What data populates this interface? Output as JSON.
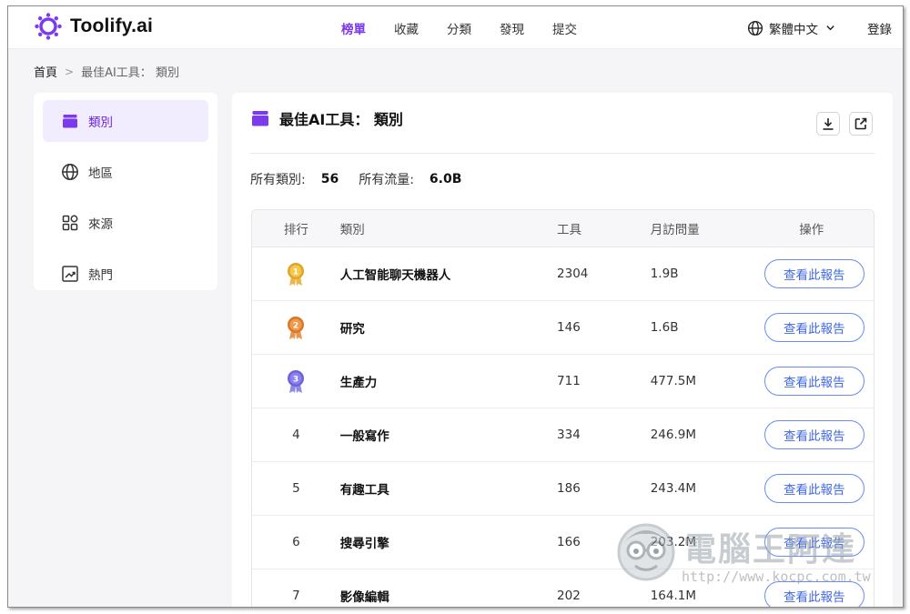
{
  "header": {
    "logo_text": "Toolify.ai",
    "nav": [
      {
        "label": "榜單",
        "active": true
      },
      {
        "label": "收藏",
        "active": false
      },
      {
        "label": "分類",
        "active": false
      },
      {
        "label": "發現",
        "active": false
      },
      {
        "label": "提交",
        "active": false
      }
    ],
    "language": "繁體中文",
    "login": "登錄"
  },
  "breadcrumb": {
    "home": "首頁",
    "current": "最佳AI工具： 類別"
  },
  "sidebar": {
    "items": [
      {
        "label": "類別",
        "icon": "folder-icon",
        "active": true
      },
      {
        "label": "地區",
        "icon": "globe-icon",
        "active": false
      },
      {
        "label": "來源",
        "icon": "apps-icon",
        "active": false
      },
      {
        "label": "熱門",
        "icon": "trending-icon",
        "active": false
      }
    ]
  },
  "main": {
    "title": "最佳AI工具： 類別",
    "stats": {
      "categories_label": "所有類別:",
      "categories_value": "56",
      "traffic_label": "所有流量:",
      "traffic_value": "6.0B"
    },
    "table": {
      "headers": [
        "排行",
        "類別",
        "工具",
        "月訪問量",
        "操作"
      ],
      "rows": [
        {
          "rank": "1",
          "category": "人工智能聊天機器人",
          "tools": "2304",
          "visits": "1.9B",
          "action": "查看此報告"
        },
        {
          "rank": "2",
          "category": "研究",
          "tools": "146",
          "visits": "1.6B",
          "action": "查看此報告"
        },
        {
          "rank": "3",
          "category": "生產力",
          "tools": "711",
          "visits": "477.5M",
          "action": "查看此報告"
        },
        {
          "rank": "4",
          "category": "一般寫作",
          "tools": "334",
          "visits": "246.9M",
          "action": "查看此報告"
        },
        {
          "rank": "5",
          "category": "有趣工具",
          "tools": "186",
          "visits": "243.4M",
          "action": "查看此報告"
        },
        {
          "rank": "6",
          "category": "搜尋引擎",
          "tools": "166",
          "visits": "203.2M",
          "action": "查看此報告"
        },
        {
          "rank": "7",
          "category": "影像編輯",
          "tools": "202",
          "visits": "164.1M",
          "action": "查看此報告"
        }
      ]
    }
  },
  "watermark": {
    "title": "電腦王阿達",
    "url": "http://www.kocpc.com.tw"
  },
  "colors": {
    "accent": "#7c3aed",
    "button_border": "#6a8bf2",
    "button_text": "#4169e1",
    "gold": "#e0a526",
    "bronze": "#d9772a",
    "purple_medal": "#6c63d9"
  }
}
